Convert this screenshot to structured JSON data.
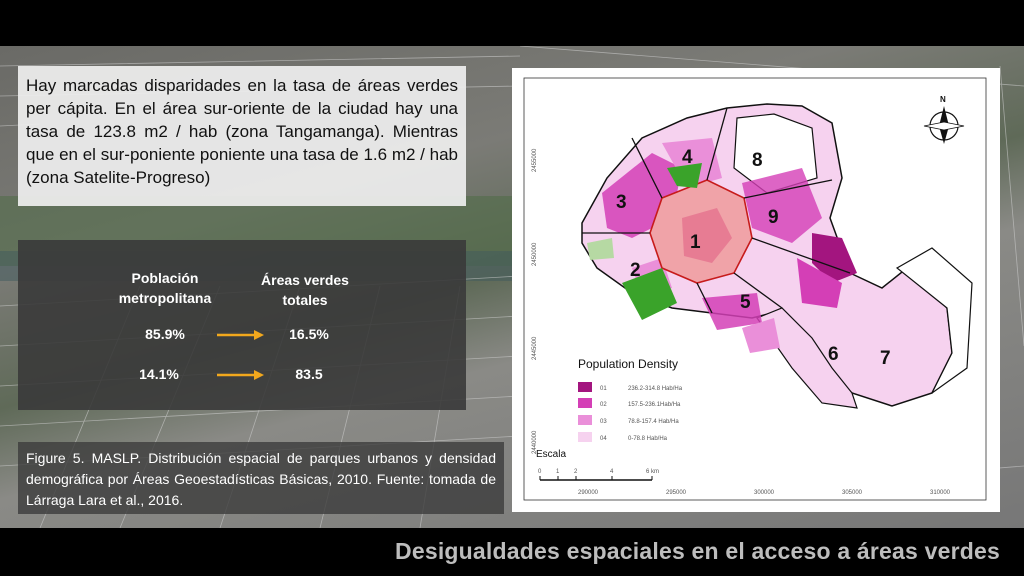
{
  "intro_text": "Hay marcadas disparidades en la tasa de áreas verdes per cápita. En el área sur-oriente de la ciudad hay una tasa de 123.8 m2 / hab (zona Tangamanga). Mientras que en el sur-poniente poniente una tasa de 1.6 m2 / hab (zona Satelite-Progreso)",
  "stats": {
    "col1_header_line1": "Población",
    "col1_header_line2": "metropolitana",
    "col2_header_line1": "Áreas verdes",
    "col2_header_line2": "totales",
    "rows": [
      {
        "left": "85.9%",
        "right": "16.5%"
      },
      {
        "left": "14.1%",
        "right": "83.5"
      }
    ],
    "arrow_color": "#f2a81d"
  },
  "caption": "Figure 5. MASLP. Distribución espacial de parques urbanos y densidad demográfica por Áreas Geoestadísticas Básicas, 2010. Fuente: tomada de Lárraga Lara et al., 2016.",
  "map": {
    "north_label": "N",
    "zones": [
      "1",
      "2",
      "3",
      "4",
      "5",
      "6",
      "7",
      "8",
      "9"
    ],
    "legend_title": "Population Density",
    "legend": [
      {
        "code": "01",
        "range": "236.2-314.8 Hab/Ha",
        "color": "#a3157f"
      },
      {
        "code": "02",
        "range": "157.5-236.1Hab/Ha",
        "color": "#d43fb6"
      },
      {
        "code": "03",
        "range": "78.8-157.4 Hab/Ha",
        "color": "#ea8fd9"
      },
      {
        "code": "04",
        "range": "0-78.8 Hab/Ha",
        "color": "#f6d2ef"
      }
    ],
    "scale_title": "Escala",
    "scale_ticks": [
      "0",
      "1",
      "2",
      "4",
      "6 km"
    ],
    "x_ticks": [
      "290000",
      "295000",
      "300000",
      "305000",
      "310000"
    ],
    "y_ticks": [
      "2455000",
      "2450000",
      "2445000",
      "2440000"
    ],
    "park_color": "#3aa32a"
  },
  "slide_title": "Desigualdades espaciales en el acceso a áreas verdes"
}
